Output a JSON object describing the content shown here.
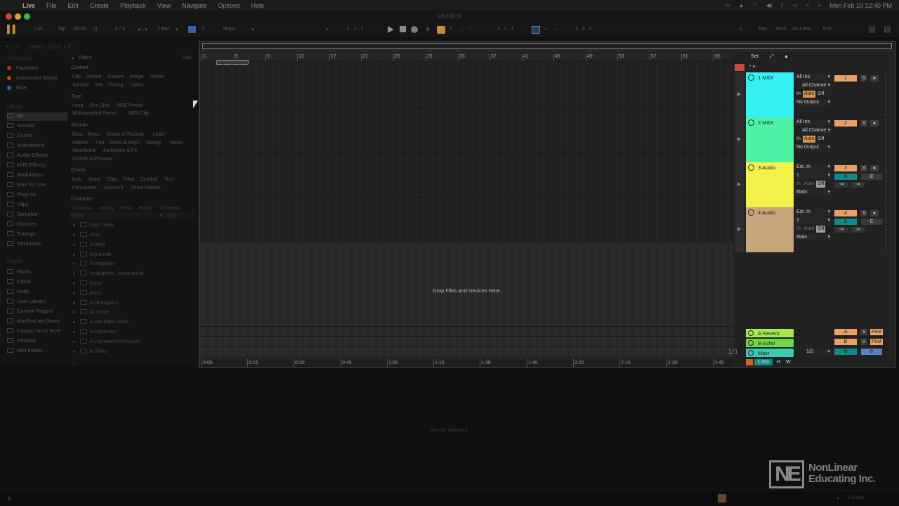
{
  "menubar": {
    "app": "Live",
    "items": [
      "File",
      "Edit",
      "Create",
      "Playback",
      "View",
      "Navigate",
      "Options",
      "Help"
    ],
    "clock": "Mon Feb 10  12:40 PM"
  },
  "window": {
    "title": "Untitled"
  },
  "control": {
    "link": "Link",
    "tap": "Tap",
    "tempo": "93.00",
    "sig": "4 / 4",
    "quant": "1 Bar",
    "key": "C",
    "scale": "Major",
    "pos1": "1 .  1 .  1",
    "loop_start": "1 .  1 .  1",
    "loop_len": "4 .  0 .  0",
    "key_btn": "Key",
    "midi_btn": "MIDI",
    "sample_rate": "44.1 kHz",
    "cpu": "0 %"
  },
  "browser": {
    "search_placeholder": "Search (Cmd + F)",
    "collections_header": "Collections",
    "collections": [
      {
        "label": "Favorites",
        "color": "#c0392b"
      },
      {
        "label": "Instrument Sampl",
        "color": "#d35400"
      },
      {
        "label": "Blue",
        "color": "#2e6bbf"
      }
    ],
    "library_header": "Library",
    "library": [
      "All",
      "Sounds",
      "Drums",
      "Instruments",
      "Audio Effects",
      "MIDI Effects",
      "Modulators",
      "Max for Live",
      "Plug-Ins",
      "Clips",
      "Samples",
      "Grooves",
      "Tunings",
      "Templates"
    ],
    "places_header": "Places",
    "places": [
      "Packs",
      "Cloud",
      "Push",
      "User Library",
      "Current Project",
      "MaxForLive Downl",
      "Classic Drum Bree",
      "Desktop",
      "Add Folder..."
    ],
    "filters_label": "Filters",
    "edit_label": "Edit",
    "content_header": "Content",
    "content_tags": [
      "Clip",
      "Device",
      "Groove",
      "Image",
      "Preset",
      "Sample",
      "Set",
      "Tuning",
      "Video"
    ],
    "type_header": "Type",
    "type_tags": [
      "Loop",
      "One Shot",
      "MPE Preset",
      "Multisampled Preset",
      "MIDI Clip"
    ],
    "sounds_header": "Sounds",
    "sounds_tags": [
      "Bass",
      "Brass",
      "Guitar & Plucked",
      "Lead",
      "Mallets",
      "Pad",
      "Piano & Keys",
      "Strings",
      "Voice",
      "Woodwind",
      "Ambience & FX",
      "Chords & Phrases"
    ],
    "drums_header": "Drums",
    "drums_tags": [
      "Kick",
      "Snare",
      "Clap",
      "Hihat",
      "Cymbal",
      "Tom",
      "Percussion",
      "Drum Kit",
      "Drum Pattern"
    ],
    "character_header": "Character",
    "character_tags": [
      "Acoustic",
      "Analog",
      "Basic",
      "Bright",
      "Chopped"
    ],
    "col_name": "Name",
    "col_size": "Size",
    "files": [
      "Align Delay",
      "Amp",
      "Analog",
      "Arp.amxd",
      "Arpeggiator",
      "Arrangeme...ooper.amxd",
      "Astra",
      "Astra",
      "AUBandpass",
      "AUDelay",
      "Audio Effect Rack",
      "AUDistortion",
      "AUDynamicsProcessor",
      "AUFilter"
    ]
  },
  "arrangement": {
    "bars": [
      "1",
      "5",
      "9",
      "13",
      "17",
      "21",
      "25",
      "29",
      "33",
      "37",
      "41",
      "45",
      "49",
      "53",
      "57",
      "61",
      "65"
    ],
    "times": [
      "0:00",
      "0:15",
      "0:30",
      "0:45",
      "1:00",
      "1:15",
      "1:30",
      "1:45",
      "2:00",
      "2:15",
      "2:30",
      "2:45"
    ],
    "drop_msg": "Drop Files and Devices Here",
    "zoom_count": "1/1",
    "set_label": "Set"
  },
  "tracks": [
    {
      "name": "1 MIDI",
      "color": "#35f2f2",
      "input": "All Ins",
      "channel": "All Channe",
      "mon": [
        "In",
        "Auto",
        "Off"
      ],
      "output": "No Output",
      "num": "1",
      "arm": "●"
    },
    {
      "name": "2 MIDI",
      "color": "#4ef2a4",
      "input": "All Ins",
      "channel": "All Channe",
      "mon": [
        "In",
        "Auto",
        "Off"
      ],
      "output": "No Output",
      "num": "2",
      "arm": "●"
    },
    {
      "name": "3 Audio",
      "color": "#f2f24a",
      "input": "Ext. In",
      "channel": "1",
      "mon": [
        "In",
        "Auto",
        "Off"
      ],
      "output": "Main",
      "num": "3",
      "vol": "0",
      "pan": "C",
      "sendA": "-∞",
      "sendB": "-∞",
      "arm": "●"
    },
    {
      "name": "4 Audio",
      "color": "#c8a47c",
      "input": "Ext. In",
      "channel": "2",
      "mon": [
        "In",
        "Auto",
        "Off"
      ],
      "output": "Main",
      "num": "4",
      "vol": "0",
      "pan": "C",
      "sendA": "-∞",
      "sendB": "-∞",
      "arm": "●"
    }
  ],
  "returns": [
    {
      "name": "A Reverb",
      "color": "#a9e84a",
      "letter": "A",
      "post": "Post"
    },
    {
      "name": "B Echo",
      "color": "#6fd94a",
      "letter": "B",
      "post": "Post"
    }
  ],
  "master": {
    "name": "Main",
    "color": "#3cc9b4",
    "cue": "1/2",
    "vol": "0",
    "vol2": "0",
    "zoom": "1.00x",
    "h": "H",
    "w": "W"
  },
  "detail": {
    "msg": "No clip selected.",
    "status_track": "3-Audio"
  },
  "watermark": {
    "logo": "NE",
    "line1": "NonLinear",
    "line2": "Educating Inc."
  }
}
